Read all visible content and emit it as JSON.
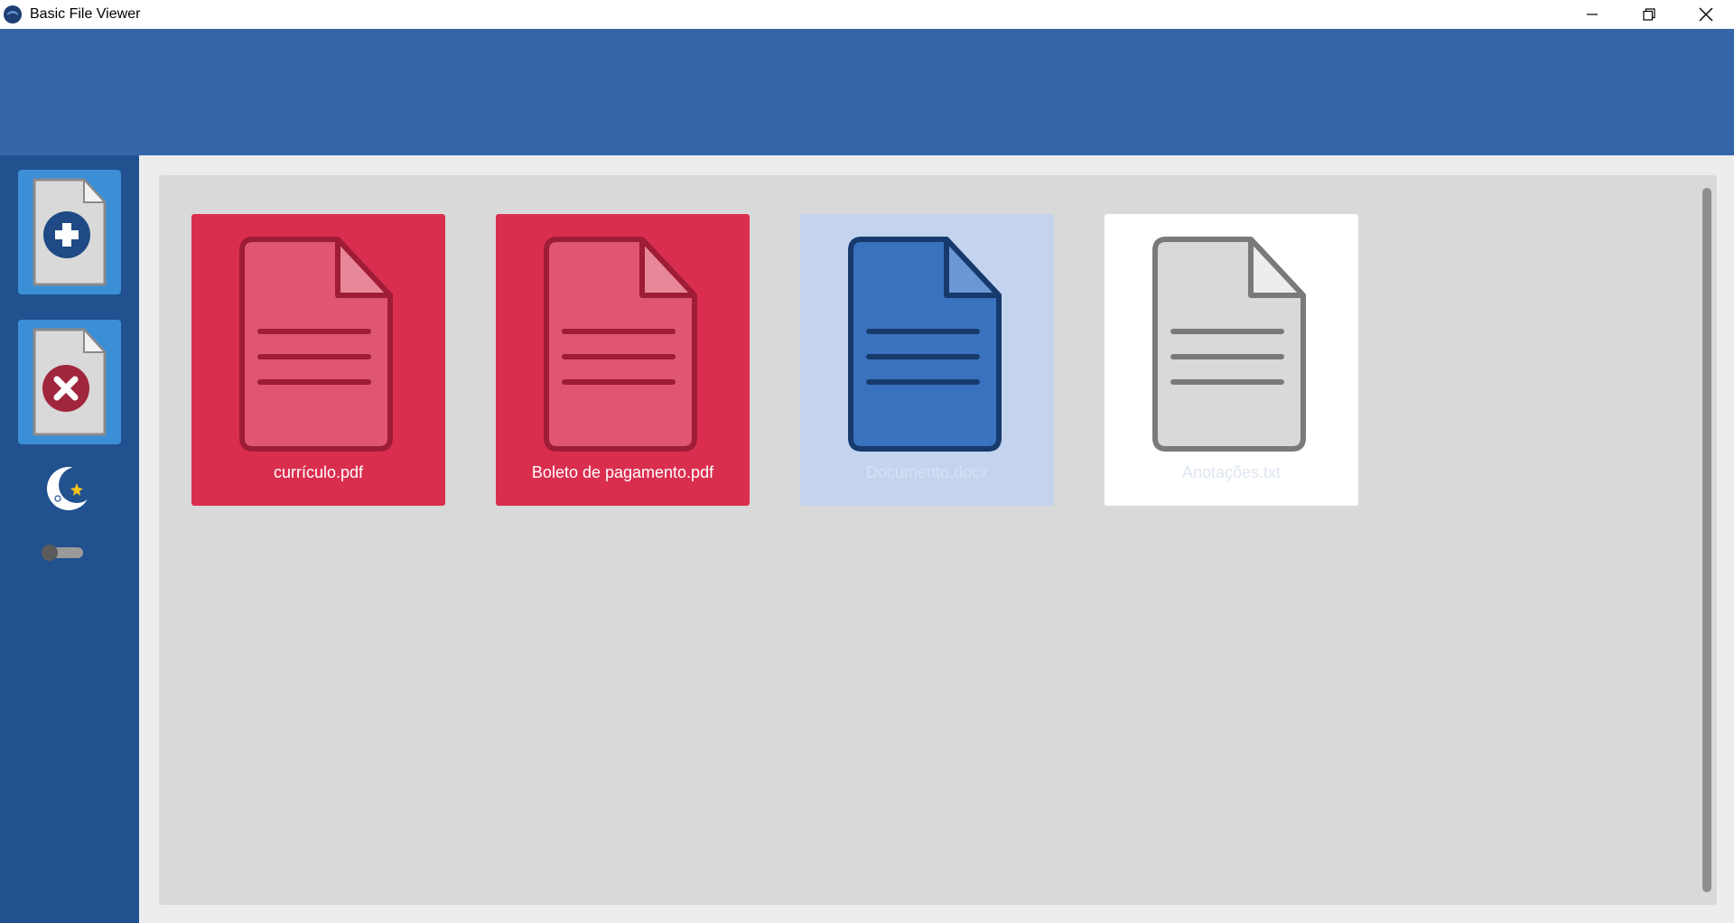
{
  "window": {
    "title": "Basic File Viewer",
    "controls": [
      {
        "name": "minimize",
        "icon": "minimize-icon"
      },
      {
        "name": "restore",
        "icon": "restore-icon"
      },
      {
        "name": "close",
        "icon": "close-icon"
      }
    ]
  },
  "sidebar": {
    "add_button_icon": "add-file-icon",
    "remove_button_icon": "remove-file-icon",
    "theme_icon": "moon-star-icon",
    "dark_mode_toggle": {
      "on": false
    }
  },
  "files": [
    {
      "name": "currículo.pdf",
      "type": "pdf"
    },
    {
      "name": "Boleto de pagamento.pdf",
      "type": "pdf"
    },
    {
      "name": "Documento.docx",
      "type": "docx"
    },
    {
      "name": "Anotações.txt",
      "type": "txt"
    }
  ],
  "colors": {
    "header": "#3466a8",
    "sidebar": "#21518f",
    "sidebar_button": "#3b8fd6",
    "pdf_card": "#da2e4f",
    "docx_card": "#c4d4ee",
    "txt_card": "#ffffff"
  }
}
